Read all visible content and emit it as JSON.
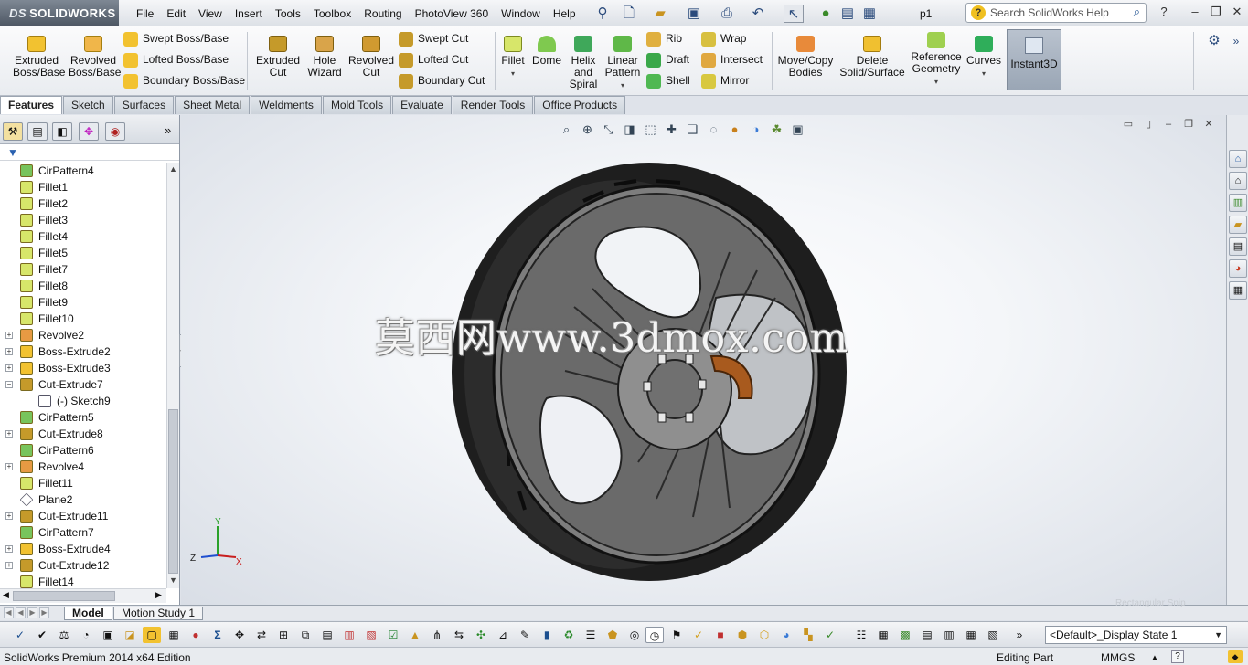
{
  "app": {
    "logo_ds": "DS",
    "logo_text": "SOLIDWORKS",
    "doc_title": "p1",
    "search_placeholder": "Search SolidWorks Help"
  },
  "menus": [
    "File",
    "Edit",
    "View",
    "Insert",
    "Tools",
    "Toolbox",
    "Routing",
    "PhotoView 360",
    "Window",
    "Help"
  ],
  "ribbon": {
    "extruded_boss": [
      "Extruded",
      "Boss/Base"
    ],
    "revolved_boss": [
      "Revolved",
      "Boss/Base"
    ],
    "swept_boss": "Swept Boss/Base",
    "lofted_boss": "Lofted Boss/Base",
    "boundary_boss": "Boundary Boss/Base",
    "extruded_cut": [
      "Extruded",
      "Cut"
    ],
    "hole_wizard": [
      "Hole",
      "Wizard"
    ],
    "revolved_cut": [
      "Revolved",
      "Cut"
    ],
    "swept_cut": "Swept Cut",
    "lofted_cut": "Lofted Cut",
    "boundary_cut": "Boundary Cut",
    "fillet": "Fillet",
    "dome": "Dome",
    "helix": [
      "Helix",
      "and",
      "Spiral"
    ],
    "linear_pattern": [
      "Linear",
      "Pattern"
    ],
    "rib": "Rib",
    "draft": "Draft",
    "shell": "Shell",
    "wrap": "Wrap",
    "intersect": "Intersect",
    "mirror": "Mirror",
    "move_copy": [
      "Move/Copy",
      "Bodies"
    ],
    "delete_solid": [
      "Delete",
      "Solid/Surface"
    ],
    "reference_geometry": [
      "Reference",
      "Geometry"
    ],
    "curves": "Curves",
    "instant3d": "Instant3D"
  },
  "tabs": [
    "Features",
    "Sketch",
    "Surfaces",
    "Sheet Metal",
    "Weldments",
    "Mold Tools",
    "Evaluate",
    "Render Tools",
    "Office Products"
  ],
  "tree": [
    {
      "label": "CirPattern4",
      "icon": "pattern",
      "expand": false
    },
    {
      "label": "Fillet1",
      "icon": "fillet",
      "expand": false
    },
    {
      "label": "Fillet2",
      "icon": "fillet",
      "expand": false
    },
    {
      "label": "Fillet3",
      "icon": "fillet",
      "expand": false
    },
    {
      "label": "Fillet4",
      "icon": "fillet",
      "expand": false
    },
    {
      "label": "Fillet5",
      "icon": "fillet",
      "expand": false
    },
    {
      "label": "Fillet7",
      "icon": "fillet",
      "expand": false
    },
    {
      "label": "Fillet8",
      "icon": "fillet",
      "expand": false
    },
    {
      "label": "Fillet9",
      "icon": "fillet",
      "expand": false
    },
    {
      "label": "Fillet10",
      "icon": "fillet",
      "expand": false
    },
    {
      "label": "Revolve2",
      "icon": "revolve",
      "expand": true
    },
    {
      "label": "Boss-Extrude2",
      "icon": "extrude",
      "expand": true
    },
    {
      "label": "Boss-Extrude3",
      "icon": "extrude",
      "expand": true
    },
    {
      "label": "Cut-Extrude7",
      "icon": "cut",
      "expand": true,
      "open": true
    },
    {
      "label": "(-) Sketch9",
      "icon": "sketch",
      "expand": false,
      "child": true
    },
    {
      "label": "CirPattern5",
      "icon": "pattern",
      "expand": false
    },
    {
      "label": "Cut-Extrude8",
      "icon": "cut",
      "expand": true
    },
    {
      "label": "CirPattern6",
      "icon": "pattern",
      "expand": false
    },
    {
      "label": "Revolve4",
      "icon": "revolve",
      "expand": true
    },
    {
      "label": "Fillet11",
      "icon": "fillet",
      "expand": false
    },
    {
      "label": "Plane2",
      "icon": "plane",
      "expand": false
    },
    {
      "label": "Cut-Extrude11",
      "icon": "cut",
      "expand": true
    },
    {
      "label": "CirPattern7",
      "icon": "pattern",
      "expand": false
    },
    {
      "label": "Boss-Extrude4",
      "icon": "extrude",
      "expand": true
    },
    {
      "label": "Cut-Extrude12",
      "icon": "cut",
      "expand": true
    },
    {
      "label": "Fillet14",
      "icon": "fillet",
      "expand": false
    }
  ],
  "viewport": {
    "watermark": "莫西网www.3dmox.com",
    "axis_y": "Y",
    "axis_z": "Z",
    "axis_x": "X"
  },
  "bottom": {
    "model_tab": "Model",
    "motion_tab": "Motion Study 1",
    "rect_snip": "Rectangular Snip",
    "display_state": "<Default>_Display State 1"
  },
  "status": {
    "edition": "SolidWorks Premium 2014 x64 Edition",
    "mode": "Editing Part",
    "units": "MMGS",
    "help": "?"
  },
  "colors": {
    "fillet": "#d7e66a",
    "extrude": "#f2c230",
    "cut": "#c59a2a",
    "pattern": "#78c45c",
    "revolve": "#e79a43",
    "tire": "#1e1e1e",
    "rim": "#5c5c5c",
    "caliper": "#a85a1e"
  }
}
